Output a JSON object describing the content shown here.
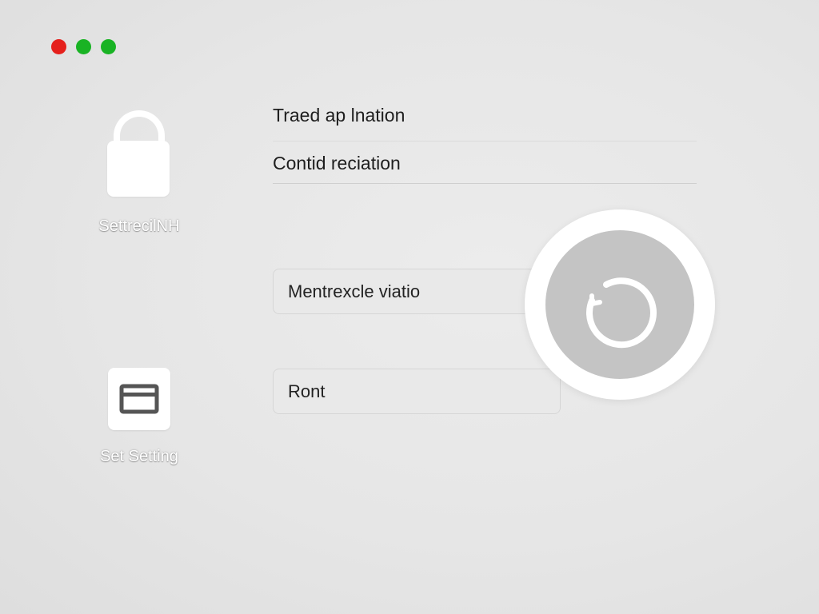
{
  "window": {
    "controls": [
      {
        "name": "close",
        "color": "#e5201c"
      },
      {
        "name": "minimize",
        "color": "#19b324"
      },
      {
        "name": "maximize",
        "color": "#19b324"
      }
    ]
  },
  "sidebar": {
    "items": [
      {
        "label": "SettrecilNH",
        "icon": "lock-icon"
      },
      {
        "label": "Set Setting",
        "icon": "folder-icon"
      }
    ]
  },
  "main": {
    "rows": [
      {
        "label": "Traed ap lnation"
      },
      {
        "label": "Contid reciation"
      }
    ],
    "fields": [
      {
        "value": "Mentrexcle viatio"
      },
      {
        "value": "Ront"
      }
    ]
  },
  "overlay": {
    "icon": "loading-spinner-icon",
    "ring_color": "#ffffff",
    "fill_color": "#c4c4c4"
  },
  "colors": {
    "background": "#e6e6e6",
    "text": "#1e1e1e"
  }
}
